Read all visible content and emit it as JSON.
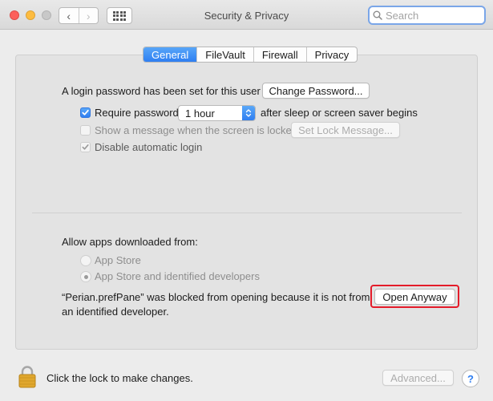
{
  "window": {
    "title": "Security & Privacy",
    "search_placeholder": "Search",
    "back_glyph": "‹",
    "forward_glyph": "›"
  },
  "tabs": [
    {
      "label": "General",
      "active": true
    },
    {
      "label": "FileVault",
      "active": false
    },
    {
      "label": "Firewall",
      "active": false
    },
    {
      "label": "Privacy",
      "active": false
    }
  ],
  "general": {
    "login_password_text": "A login password has been set for this user",
    "change_password_button": "Change Password...",
    "require_password": {
      "label": "Require password",
      "checked": true
    },
    "require_password_delay": "1 hour",
    "after_sleep_text": "after sleep or screen saver begins",
    "show_message": {
      "label": "Show a message when the screen is locked",
      "checked": false,
      "disabled": true
    },
    "set_lock_message_button": "Set Lock Message...",
    "disable_auto_login": {
      "label": "Disable automatic login",
      "checked": true,
      "disabled": true
    }
  },
  "allow_apps": {
    "heading": "Allow apps downloaded from:",
    "options": [
      {
        "label": "App Store",
        "selected": false
      },
      {
        "label": "App Store and identified developers",
        "selected": true
      }
    ],
    "blocked_message_line1": "“Perian.prefPane” was blocked from opening because it is not from",
    "blocked_message_line2": "an identified developer.",
    "open_anyway_button": "Open Anyway"
  },
  "footer": {
    "lock_text": "Click the lock to make changes.",
    "advanced_button": "Advanced...",
    "help_glyph": "?"
  },
  "colors": {
    "accent": "#2f7ef1",
    "highlight_box": "#e41c2a",
    "lock_gold": "#e0a72e"
  }
}
